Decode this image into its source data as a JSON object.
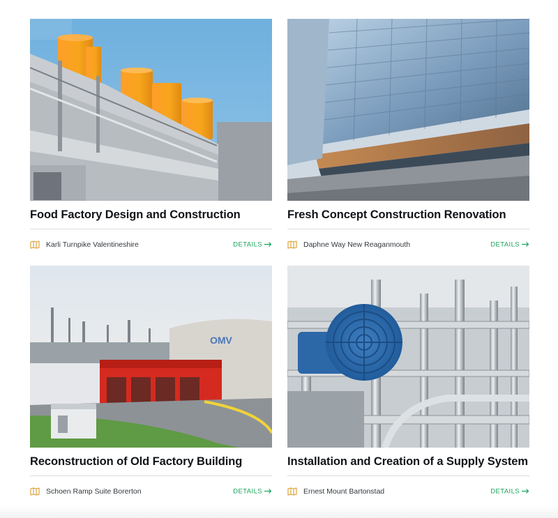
{
  "projects": [
    {
      "title": "Food Factory Design and Construction",
      "address": "Karli Turnpike Valentineshire",
      "details_label": "DETAILS",
      "image": "factory-orange-tanks-photo"
    },
    {
      "title": "Fresh Concept Construction Renovation",
      "address": "Daphne Way New Reaganmouth",
      "details_label": "DETAILS",
      "image": "glass-office-building-photo"
    },
    {
      "title": "Reconstruction of Old Factory Building",
      "address": "Schoen Ramp Suite Borerton",
      "details_label": "DETAILS",
      "image": "red-factory-refinery-photo"
    },
    {
      "title": "Installation and Creation of a Supply System",
      "address": "Ernest Mount Bartonstad",
      "details_label": "DETAILS",
      "image": "pipes-and-motor-photo"
    }
  ],
  "icons": {
    "location": "map-icon",
    "details": "arrow-right-icon"
  },
  "colors": {
    "accent": "#1aa35b",
    "location_icon": "#d99b2b",
    "title": "#111418"
  }
}
